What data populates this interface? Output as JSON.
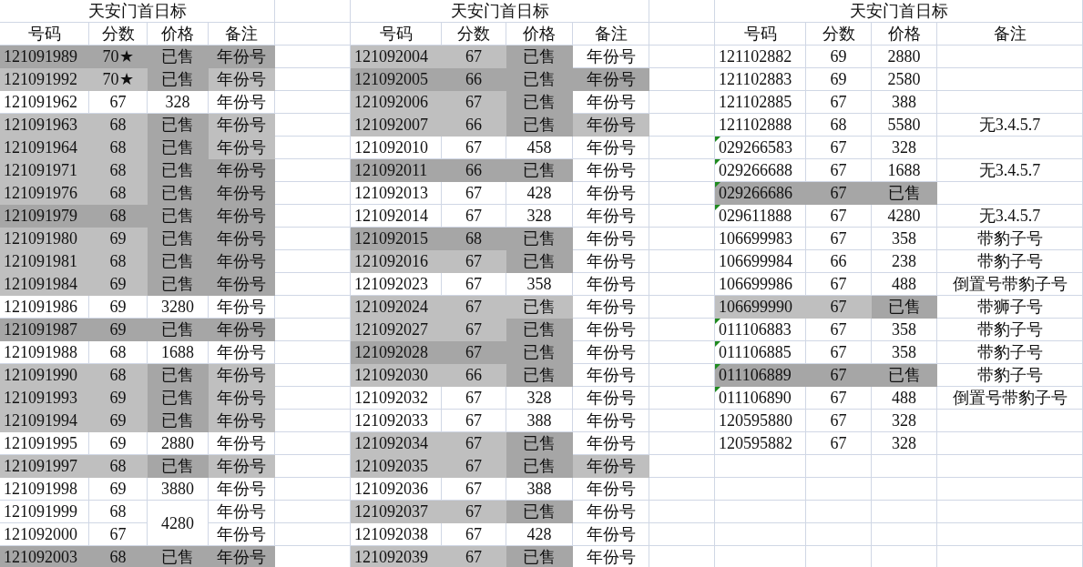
{
  "sheet": {
    "tables": [
      {
        "title": "天安门首日标",
        "columns": [
          "号码",
          "分数",
          "价格",
          "备注"
        ],
        "rows": [
          {
            "cells": [
              {
                "text": "121091989",
                "color": "#a6a6a6"
              },
              {
                "text": "70★",
                "color": "#a6a6a6"
              },
              {
                "text": "已售",
                "color": "#a6a6a6"
              },
              {
                "text": "年份号",
                "color": "#a6a6a6"
              }
            ]
          },
          {
            "cells": [
              {
                "text": "121091992",
                "color": "#bfbfbf"
              },
              {
                "text": "70★",
                "color": "#bfbfbf"
              },
              {
                "text": "已售",
                "color": "#a6a6a6"
              },
              {
                "text": "年份号",
                "color": "#bfbfbf"
              }
            ]
          },
          {
            "cells": [
              {
                "text": "121091962"
              },
              {
                "text": "67"
              },
              {
                "text": "328"
              },
              {
                "text": "年份号"
              }
            ]
          },
          {
            "cells": [
              {
                "text": "121091963",
                "color": "#bfbfbf"
              },
              {
                "text": "68",
                "color": "#bfbfbf"
              },
              {
                "text": "已售",
                "color": "#a6a6a6"
              },
              {
                "text": "年份号",
                "color": "#bfbfbf"
              }
            ]
          },
          {
            "cells": [
              {
                "text": "121091964",
                "color": "#bfbfbf"
              },
              {
                "text": "68",
                "color": "#bfbfbf"
              },
              {
                "text": "已售",
                "color": "#a6a6a6"
              },
              {
                "text": "年份号",
                "color": "#bfbfbf"
              }
            ]
          },
          {
            "cells": [
              {
                "text": "121091971",
                "color": "#bfbfbf"
              },
              {
                "text": "68",
                "color": "#bfbfbf"
              },
              {
                "text": "已售",
                "color": "#a6a6a6"
              },
              {
                "text": "年份号",
                "color": "#a6a6a6"
              }
            ]
          },
          {
            "cells": [
              {
                "text": "121091976",
                "color": "#bfbfbf"
              },
              {
                "text": "68",
                "color": "#bfbfbf"
              },
              {
                "text": "已售",
                "color": "#a6a6a6"
              },
              {
                "text": "年份号",
                "color": "#a6a6a6"
              }
            ]
          },
          {
            "cells": [
              {
                "text": "121091979",
                "color": "#a6a6a6"
              },
              {
                "text": "68",
                "color": "#a6a6a6"
              },
              {
                "text": "已售",
                "color": "#a6a6a6"
              },
              {
                "text": "年份号",
                "color": "#a6a6a6"
              }
            ]
          },
          {
            "cells": [
              {
                "text": "121091980",
                "color": "#bfbfbf"
              },
              {
                "text": "69",
                "color": "#bfbfbf"
              },
              {
                "text": "已售",
                "color": "#a6a6a6"
              },
              {
                "text": "年份号",
                "color": "#a6a6a6"
              }
            ]
          },
          {
            "cells": [
              {
                "text": "121091981",
                "color": "#bfbfbf"
              },
              {
                "text": "68",
                "color": "#bfbfbf"
              },
              {
                "text": "已售",
                "color": "#a6a6a6"
              },
              {
                "text": "年份号",
                "color": "#a6a6a6"
              }
            ]
          },
          {
            "cells": [
              {
                "text": "121091984",
                "color": "#bfbfbf"
              },
              {
                "text": "69",
                "color": "#bfbfbf"
              },
              {
                "text": "已售",
                "color": "#a6a6a6"
              },
              {
                "text": "年份号",
                "color": "#a6a6a6"
              }
            ]
          },
          {
            "cells": [
              {
                "text": "121091986"
              },
              {
                "text": "69"
              },
              {
                "text": "3280"
              },
              {
                "text": "年份号"
              }
            ]
          },
          {
            "cells": [
              {
                "text": "121091987",
                "color": "#a6a6a6"
              },
              {
                "text": "69",
                "color": "#a6a6a6"
              },
              {
                "text": "已售",
                "color": "#a6a6a6"
              },
              {
                "text": "年份号",
                "color": "#a6a6a6"
              }
            ]
          },
          {
            "cells": [
              {
                "text": "121091988"
              },
              {
                "text": "68"
              },
              {
                "text": "1688"
              },
              {
                "text": "年份号"
              }
            ]
          },
          {
            "cells": [
              {
                "text": "121091990",
                "color": "#bfbfbf"
              },
              {
                "text": "68",
                "color": "#bfbfbf"
              },
              {
                "text": "已售",
                "color": "#a6a6a6"
              },
              {
                "text": "年份号",
                "color": "#bfbfbf"
              }
            ]
          },
          {
            "cells": [
              {
                "text": "121091993",
                "color": "#bfbfbf"
              },
              {
                "text": "69",
                "color": "#bfbfbf"
              },
              {
                "text": "已售",
                "color": "#a6a6a6"
              },
              {
                "text": "年份号",
                "color": "#bfbfbf"
              }
            ]
          },
          {
            "cells": [
              {
                "text": "121091994",
                "color": "#bfbfbf"
              },
              {
                "text": "69",
                "color": "#bfbfbf"
              },
              {
                "text": "已售",
                "color": "#a6a6a6"
              },
              {
                "text": "年份号",
                "color": "#bfbfbf"
              }
            ]
          },
          {
            "cells": [
              {
                "text": "121091995"
              },
              {
                "text": "69"
              },
              {
                "text": "2880"
              },
              {
                "text": "年份号"
              }
            ]
          },
          {
            "cells": [
              {
                "text": "121091997",
                "color": "#bfbfbf"
              },
              {
                "text": "68",
                "color": "#bfbfbf"
              },
              {
                "text": "已售",
                "color": "#a6a6a6"
              },
              {
                "text": "年份号",
                "color": "#bfbfbf"
              }
            ]
          },
          {
            "cells": [
              {
                "text": "121091998"
              },
              {
                "text": "69"
              },
              {
                "text": "3880"
              },
              {
                "text": "年份号"
              }
            ]
          },
          {
            "cells": [
              {
                "text": "121091999"
              },
              {
                "text": "68"
              },
              {
                "text": "4280"
              },
              {
                "text": "年份号"
              }
            ]
          },
          {
            "cells": [
              {
                "text": "121092000"
              },
              {
                "text": "67"
              },
              {
                "merged": true
              },
              {
                "text": "年份号"
              }
            ]
          },
          {
            "cells": [
              {
                "text": "121092003",
                "color": "#a6a6a6"
              },
              {
                "text": "68",
                "color": "#a6a6a6"
              },
              {
                "text": "已售",
                "color": "#a6a6a6"
              },
              {
                "text": "年份号",
                "color": "#a6a6a6"
              }
            ]
          }
        ]
      },
      {
        "title": "天安门首日标",
        "columns": [
          "号码",
          "分数",
          "价格",
          "备注"
        ],
        "rows": [
          {
            "cells": [
              {
                "text": "121092004",
                "color": "#bfbfbf"
              },
              {
                "text": "67",
                "color": "#bfbfbf"
              },
              {
                "text": "已售",
                "color": "#a6a6a6"
              },
              {
                "text": "年份号"
              }
            ]
          },
          {
            "cells": [
              {
                "text": "121092005",
                "color": "#a6a6a6"
              },
              {
                "text": "66",
                "color": "#a6a6a6"
              },
              {
                "text": "已售",
                "color": "#a6a6a6"
              },
              {
                "text": "年份号",
                "color": "#a6a6a6"
              }
            ]
          },
          {
            "cells": [
              {
                "text": "121092006",
                "color": "#bfbfbf"
              },
              {
                "text": "67",
                "color": "#bfbfbf"
              },
              {
                "text": "已售",
                "color": "#a6a6a6"
              },
              {
                "text": "年份号"
              }
            ]
          },
          {
            "cells": [
              {
                "text": "121092007",
                "color": "#bfbfbf"
              },
              {
                "text": "66",
                "color": "#bfbfbf"
              },
              {
                "text": "已售",
                "color": "#a6a6a6"
              },
              {
                "text": "年份号",
                "color": "#bfbfbf"
              }
            ]
          },
          {
            "cells": [
              {
                "text": "121092010"
              },
              {
                "text": "67"
              },
              {
                "text": "458"
              },
              {
                "text": "年份号"
              }
            ]
          },
          {
            "cells": [
              {
                "text": "121092011",
                "color": "#a6a6a6"
              },
              {
                "text": "66",
                "color": "#a6a6a6"
              },
              {
                "text": "已售",
                "color": "#a6a6a6"
              },
              {
                "text": "年份号"
              }
            ]
          },
          {
            "cells": [
              {
                "text": "121092013"
              },
              {
                "text": "67"
              },
              {
                "text": "428"
              },
              {
                "text": "年份号"
              }
            ]
          },
          {
            "cells": [
              {
                "text": "121092014"
              },
              {
                "text": "67"
              },
              {
                "text": "328"
              },
              {
                "text": "年份号"
              }
            ]
          },
          {
            "cells": [
              {
                "text": "121092015",
                "color": "#a6a6a6"
              },
              {
                "text": "68",
                "color": "#a6a6a6"
              },
              {
                "text": "已售",
                "color": "#a6a6a6"
              },
              {
                "text": "年份号"
              }
            ]
          },
          {
            "cells": [
              {
                "text": "121092016",
                "color": "#bfbfbf"
              },
              {
                "text": "67",
                "color": "#bfbfbf"
              },
              {
                "text": "已售",
                "color": "#a6a6a6"
              },
              {
                "text": "年份号"
              }
            ]
          },
          {
            "cells": [
              {
                "text": "121092023"
              },
              {
                "text": "67"
              },
              {
                "text": "358"
              },
              {
                "text": "年份号"
              }
            ]
          },
          {
            "cells": [
              {
                "text": "121092024",
                "color": "#bfbfbf"
              },
              {
                "text": "67",
                "color": "#bfbfbf"
              },
              {
                "text": "已售",
                "color": "#bfbfbf"
              },
              {
                "text": "年份号"
              }
            ]
          },
          {
            "cells": [
              {
                "text": "121092027",
                "color": "#bfbfbf"
              },
              {
                "text": "67",
                "color": "#bfbfbf"
              },
              {
                "text": "已售",
                "color": "#a6a6a6"
              },
              {
                "text": "年份号"
              }
            ]
          },
          {
            "cells": [
              {
                "text": "121092028",
                "color": "#a6a6a6"
              },
              {
                "text": "67",
                "color": "#a6a6a6"
              },
              {
                "text": "已售",
                "color": "#a6a6a6"
              },
              {
                "text": "年份号"
              }
            ]
          },
          {
            "cells": [
              {
                "text": "121092030",
                "color": "#bfbfbf"
              },
              {
                "text": "66",
                "color": "#bfbfbf"
              },
              {
                "text": "已售",
                "color": "#a6a6a6"
              },
              {
                "text": "年份号"
              }
            ]
          },
          {
            "cells": [
              {
                "text": "121092032"
              },
              {
                "text": "67"
              },
              {
                "text": "328"
              },
              {
                "text": "年份号"
              }
            ]
          },
          {
            "cells": [
              {
                "text": "121092033"
              },
              {
                "text": "67"
              },
              {
                "text": "388"
              },
              {
                "text": "年份号"
              }
            ]
          },
          {
            "cells": [
              {
                "text": "121092034",
                "color": "#bfbfbf"
              },
              {
                "text": "67",
                "color": "#bfbfbf"
              },
              {
                "text": "已售",
                "color": "#a6a6a6"
              },
              {
                "text": "年份号"
              }
            ]
          },
          {
            "cells": [
              {
                "text": "121092035",
                "color": "#bfbfbf"
              },
              {
                "text": "67",
                "color": "#bfbfbf"
              },
              {
                "text": "已售",
                "color": "#a6a6a6"
              },
              {
                "text": "年份号",
                "color": "#bfbfbf"
              }
            ]
          },
          {
            "cells": [
              {
                "text": "121092036"
              },
              {
                "text": "67"
              },
              {
                "text": "388"
              },
              {
                "text": "年份号"
              }
            ]
          },
          {
            "cells": [
              {
                "text": "121092037",
                "color": "#bfbfbf"
              },
              {
                "text": "67",
                "color": "#bfbfbf"
              },
              {
                "text": "已售",
                "color": "#a6a6a6"
              },
              {
                "text": "年份号"
              }
            ]
          },
          {
            "cells": [
              {
                "text": "121092038"
              },
              {
                "text": "67"
              },
              {
                "text": "428"
              },
              {
                "text": "年份号"
              }
            ]
          },
          {
            "cells": [
              {
                "text": "121092039",
                "color": "#bfbfbf"
              },
              {
                "text": "67",
                "color": "#bfbfbf"
              },
              {
                "text": "已售",
                "color": "#a6a6a6"
              },
              {
                "text": "年份号"
              }
            ]
          }
        ]
      },
      {
        "title": "天安门首日标",
        "columns": [
          "号码",
          "分数",
          "价格",
          "备注"
        ],
        "rows": [
          {
            "flagged": false,
            "cells": [
              {
                "text": "121102882"
              },
              {
                "text": "69"
              },
              {
                "text": "2880"
              }
            ]
          },
          {
            "flagged": false,
            "cells": [
              {
                "text": "121102883"
              },
              {
                "text": "69"
              },
              {
                "text": "2580"
              }
            ]
          },
          {
            "flagged": false,
            "cells": [
              {
                "text": "121102885"
              },
              {
                "text": "67"
              },
              {
                "text": "388"
              }
            ]
          },
          {
            "flagged": false,
            "cells": [
              {
                "text": "121102888"
              },
              {
                "text": "68"
              },
              {
                "text": "5580"
              },
              {
                "text": "无3.4.5.7"
              }
            ]
          },
          {
            "flagged": true,
            "cells": [
              {
                "text": "029266583"
              },
              {
                "text": "67"
              },
              {
                "text": "328"
              }
            ]
          },
          {
            "flagged": true,
            "cells": [
              {
                "text": "029266688"
              },
              {
                "text": "67"
              },
              {
                "text": "1688"
              },
              {
                "text": "无3.4.5.7"
              }
            ]
          },
          {
            "flagged": true,
            "cells": [
              {
                "text": "029266686",
                "color": "#a6a6a6"
              },
              {
                "text": "67",
                "color": "#a6a6a6"
              },
              {
                "text": "已售",
                "color": "#a6a6a6"
              }
            ]
          },
          {
            "flagged": true,
            "cells": [
              {
                "text": "029611888"
              },
              {
                "text": "67"
              },
              {
                "text": "4280"
              },
              {
                "text": "无3.4.5.7"
              }
            ]
          },
          {
            "flagged": false,
            "cells": [
              {
                "text": "106699983"
              },
              {
                "text": "67"
              },
              {
                "text": "358"
              },
              {
                "text": "带豹子号"
              }
            ]
          },
          {
            "flagged": false,
            "cells": [
              {
                "text": "106699984"
              },
              {
                "text": "66"
              },
              {
                "text": "238"
              },
              {
                "text": "带豹子号"
              }
            ]
          },
          {
            "flagged": false,
            "cells": [
              {
                "text": "106699986"
              },
              {
                "text": "67"
              },
              {
                "text": "488"
              },
              {
                "text": "倒置号带豹子号"
              }
            ]
          },
          {
            "flagged": false,
            "cells": [
              {
                "text": "106699990",
                "color": "#bfbfbf"
              },
              {
                "text": "67",
                "color": "#bfbfbf"
              },
              {
                "text": "已售",
                "color": "#a6a6a6"
              },
              {
                "text": "带狮子号"
              }
            ]
          },
          {
            "flagged": true,
            "cells": [
              {
                "text": "011106883"
              },
              {
                "text": "67"
              },
              {
                "text": "358"
              },
              {
                "text": "带豹子号"
              }
            ]
          },
          {
            "flagged": true,
            "cells": [
              {
                "text": "011106885"
              },
              {
                "text": "67"
              },
              {
                "text": "358"
              },
              {
                "text": "带豹子号"
              }
            ]
          },
          {
            "flagged": true,
            "cells": [
              {
                "text": "011106889",
                "color": "#a6a6a6"
              },
              {
                "text": "67",
                "color": "#a6a6a6"
              },
              {
                "text": "已售",
                "color": "#a6a6a6"
              },
              {
                "text": "带豹子号"
              }
            ]
          },
          {
            "flagged": true,
            "cells": [
              {
                "text": "011106890"
              },
              {
                "text": "67"
              },
              {
                "text": "488"
              },
              {
                "text": "倒置号带豹子号"
              }
            ]
          },
          {
            "flagged": false,
            "cells": [
              {
                "text": "120595880"
              },
              {
                "text": "67"
              },
              {
                "text": "328"
              }
            ]
          },
          {
            "flagged": false,
            "cells": [
              {
                "text": "120595882"
              },
              {
                "text": "67"
              },
              {
                "text": "328"
              }
            ]
          }
        ]
      }
    ]
  }
}
